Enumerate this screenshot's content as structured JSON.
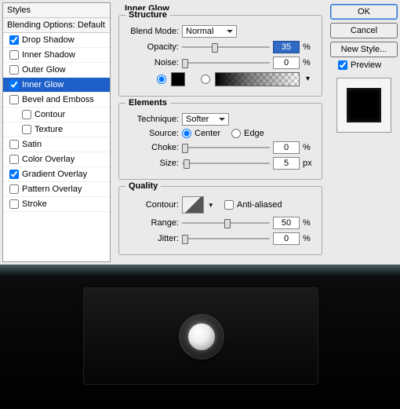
{
  "styles": {
    "header": "Styles",
    "subheader": "Blending Options: Default",
    "items": [
      {
        "label": "Drop Shadow",
        "checked": true,
        "selected": false
      },
      {
        "label": "Inner Shadow",
        "checked": false,
        "selected": false
      },
      {
        "label": "Outer Glow",
        "checked": false,
        "selected": false
      },
      {
        "label": "Inner Glow",
        "checked": true,
        "selected": true
      },
      {
        "label": "Bevel and Emboss",
        "checked": false,
        "selected": false
      },
      {
        "label": "Contour",
        "checked": false,
        "selected": false,
        "indent": true
      },
      {
        "label": "Texture",
        "checked": false,
        "selected": false,
        "indent": true
      },
      {
        "label": "Satin",
        "checked": false,
        "selected": false
      },
      {
        "label": "Color Overlay",
        "checked": false,
        "selected": false
      },
      {
        "label": "Gradient Overlay",
        "checked": true,
        "selected": false
      },
      {
        "label": "Pattern Overlay",
        "checked": false,
        "selected": false
      },
      {
        "label": "Stroke",
        "checked": false,
        "selected": false
      }
    ]
  },
  "innerglow": {
    "title": "Inner Glow",
    "structure": {
      "title": "Structure",
      "blendmode_label": "Blend Mode:",
      "blendmode_value": "Normal",
      "opacity_label": "Opacity:",
      "opacity_value": "35",
      "opacity_unit": "%",
      "noise_label": "Noise:",
      "noise_value": "0",
      "noise_unit": "%"
    },
    "elements": {
      "title": "Elements",
      "technique_label": "Technique:",
      "technique_value": "Softer",
      "source_label": "Source:",
      "source_center": "Center",
      "source_edge": "Edge",
      "choke_label": "Choke:",
      "choke_value": "0",
      "choke_unit": "%",
      "size_label": "Size:",
      "size_value": "5",
      "size_unit": "px"
    },
    "quality": {
      "title": "Quality",
      "contour_label": "Contour:",
      "antialiased_label": "Anti-aliased",
      "range_label": "Range:",
      "range_value": "50",
      "range_unit": "%",
      "jitter_label": "Jitter:",
      "jitter_value": "0",
      "jitter_unit": "%"
    }
  },
  "buttons": {
    "ok": "OK",
    "cancel": "Cancel",
    "newstyle": "New Style...",
    "preview": "Preview"
  }
}
